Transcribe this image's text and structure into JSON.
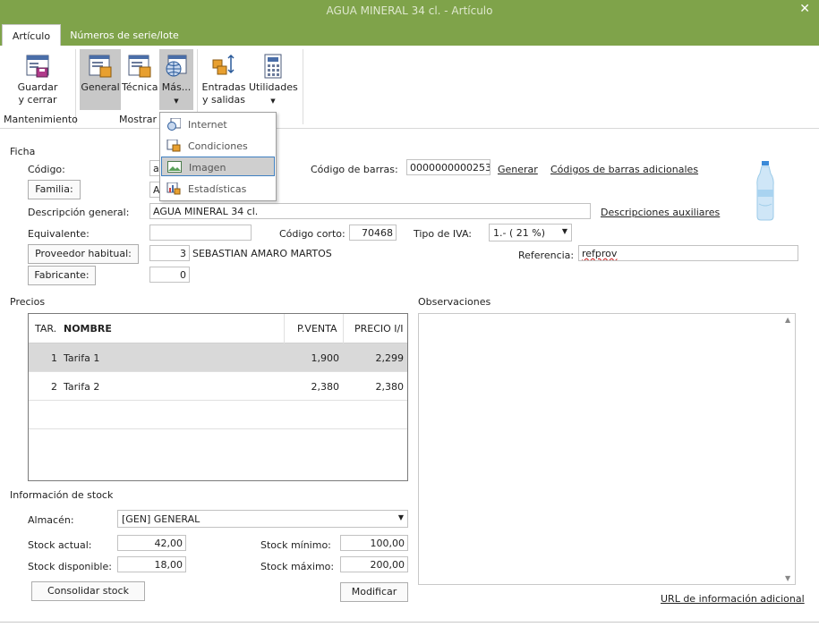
{
  "window": {
    "title": "AGUA MINERAL 34 cl. - Artículo",
    "close": "✕"
  },
  "tabs": [
    {
      "label": "Artículo",
      "active": true
    },
    {
      "label": "Números de serie/lote",
      "active": false
    }
  ],
  "ribbon": {
    "guardar_l1": "Guardar",
    "guardar_l2": "y cerrar",
    "general": "General",
    "tecnica": "Técnica",
    "mas": "Más...",
    "entradas_l1": "Entradas",
    "entradas_l2": "y salidas",
    "utilidades": "Utilidades",
    "group_mantenimiento": "Mantenimiento",
    "group_mostrar": "Mostrar"
  },
  "dropdown": {
    "items": [
      "Internet",
      "Condiciones",
      "Imagen",
      "Estadísticas"
    ],
    "highlighted": "Imagen"
  },
  "ficha": {
    "section": "Ficha",
    "codigo_label": "Código:",
    "codigo_value": "ag",
    "familia_button": "Familia:",
    "familia_value": "A(",
    "codigo_barras_label": "Código de barras:",
    "codigo_barras_value": "0000000000253",
    "generar_link": "Generar",
    "codigos_adicionales_link": "Códigos de barras adicionales",
    "descripcion_label": "Descripción general:",
    "descripcion_value": "AGUA MINERAL 34 cl.",
    "descripciones_link": "Descripciones auxiliares",
    "equivalente_label": "Equivalente:",
    "equivalente_value": "",
    "codigo_corto_label": "Código corto:",
    "codigo_corto_value": "70468",
    "tipo_iva_label": "Tipo de IVA:",
    "tipo_iva_value": "1.- ( 21 %)",
    "proveedor_button": "Proveedor habitual:",
    "proveedor_num": "3",
    "proveedor_name": "SEBASTIAN AMARO MARTOS",
    "referencia_label": "Referencia:",
    "referencia_value": "refprov",
    "fabricante_button": "Fabricante:",
    "fabricante_num": "0"
  },
  "precios": {
    "section": "Precios",
    "headers": {
      "tar": "TAR.",
      "nombre": "NOMBRE",
      "pventa": "P.VENTA",
      "precio_ii": "PRECIO I/I"
    },
    "rows": [
      {
        "tar": "1",
        "nombre": "Tarifa 1",
        "pventa": "1,900",
        "precio_ii": "2,299"
      },
      {
        "tar": "2",
        "nombre": "Tarifa 2",
        "pventa": "2,380",
        "precio_ii": "2,380"
      }
    ]
  },
  "observaciones": {
    "label": "Observaciones",
    "url_link": "URL de información adicional"
  },
  "stock": {
    "section": "Información de stock",
    "almacen_label": "Almacén:",
    "almacen_value": "[GEN] GENERAL",
    "actual_label": "Stock actual:",
    "actual_value": "42,00",
    "disponible_label": "Stock disponible:",
    "disponible_value": "18,00",
    "minimo_label": "Stock mínimo:",
    "minimo_value": "100,00",
    "maximo_label": "Stock máximo:",
    "maximo_value": "200,00",
    "consolidar_button": "Consolidar stock",
    "modificar_button": "Modificar"
  },
  "colors": {
    "titlebar": "#7fa34a",
    "selected": "#c8c8c8",
    "highlight_border": "#3e7fc1"
  }
}
